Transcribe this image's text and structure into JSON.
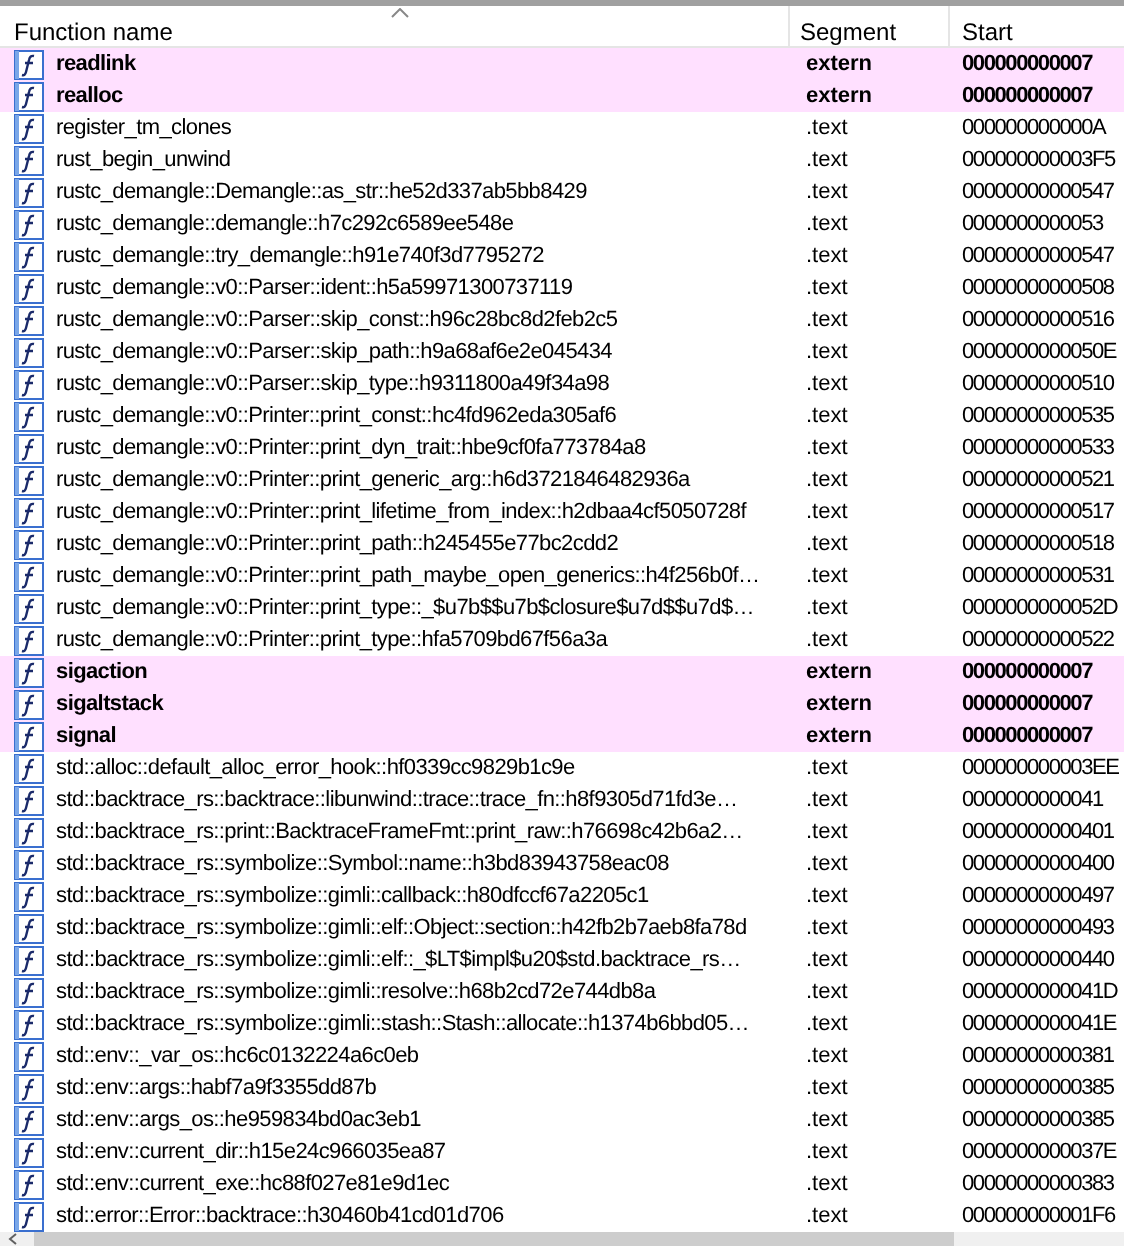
{
  "columns": [
    "Function name",
    "Segment",
    "Start"
  ],
  "rows": [
    {
      "name": "readlink",
      "segment": "extern",
      "start": "000000000007",
      "imported": true
    },
    {
      "name": "realloc",
      "segment": "extern",
      "start": "000000000007",
      "imported": true
    },
    {
      "name": "register_tm_clones",
      "segment": ".text",
      "start": "000000000000A",
      "imported": false
    },
    {
      "name": "rust_begin_unwind",
      "segment": ".text",
      "start": "000000000003F5",
      "imported": false
    },
    {
      "name": "rustc_demangle::Demangle::as_str::he52d337ab5bb8429",
      "segment": ".text",
      "start": "00000000000547",
      "imported": false
    },
    {
      "name": "rustc_demangle::demangle::h7c292c6589ee548e",
      "segment": ".text",
      "start": "0000000000053",
      "imported": false
    },
    {
      "name": "rustc_demangle::try_demangle::h91e740f3d7795272",
      "segment": ".text",
      "start": "00000000000547",
      "imported": false
    },
    {
      "name": "rustc_demangle::v0::Parser::ident::h5a59971300737119",
      "segment": ".text",
      "start": "00000000000508",
      "imported": false
    },
    {
      "name": "rustc_demangle::v0::Parser::skip_const::h96c28bc8d2feb2c5",
      "segment": ".text",
      "start": "00000000000516",
      "imported": false
    },
    {
      "name": "rustc_demangle::v0::Parser::skip_path::h9a68af6e2e045434",
      "segment": ".text",
      "start": "0000000000050E",
      "imported": false
    },
    {
      "name": "rustc_demangle::v0::Parser::skip_type::h9311800a49f34a98",
      "segment": ".text",
      "start": "00000000000510",
      "imported": false
    },
    {
      "name": "rustc_demangle::v0::Printer::print_const::hc4fd962eda305af6",
      "segment": ".text",
      "start": "00000000000535",
      "imported": false
    },
    {
      "name": "rustc_demangle::v0::Printer::print_dyn_trait::hbe9cf0fa773784a8",
      "segment": ".text",
      "start": "00000000000533",
      "imported": false
    },
    {
      "name": "rustc_demangle::v0::Printer::print_generic_arg::h6d3721846482936a",
      "segment": ".text",
      "start": "00000000000521",
      "imported": false
    },
    {
      "name": "rustc_demangle::v0::Printer::print_lifetime_from_index::h2dbaa4cf5050728f",
      "segment": ".text",
      "start": "00000000000517",
      "imported": false
    },
    {
      "name": "rustc_demangle::v0::Printer::print_path::h245455e77bc2cdd2",
      "segment": ".text",
      "start": "00000000000518",
      "imported": false
    },
    {
      "name": "rustc_demangle::v0::Printer::print_path_maybe_open_generics::h4f256b0f…",
      "segment": ".text",
      "start": "00000000000531",
      "imported": false
    },
    {
      "name": "rustc_demangle::v0::Printer::print_type::_$u7b$$u7b$closure$u7d$$u7d$…",
      "segment": ".text",
      "start": "0000000000052D",
      "imported": false
    },
    {
      "name": "rustc_demangle::v0::Printer::print_type::hfa5709bd67f56a3a",
      "segment": ".text",
      "start": "00000000000522",
      "imported": false
    },
    {
      "name": "sigaction",
      "segment": "extern",
      "start": "000000000007",
      "imported": true
    },
    {
      "name": "sigaltstack",
      "segment": "extern",
      "start": "000000000007",
      "imported": true
    },
    {
      "name": "signal",
      "segment": "extern",
      "start": "000000000007",
      "imported": true
    },
    {
      "name": "std::alloc::default_alloc_error_hook::hf0339cc9829b1c9e",
      "segment": ".text",
      "start": "000000000003EE",
      "imported": false
    },
    {
      "name": "std::backtrace_rs::backtrace::libunwind::trace::trace_fn::h8f9305d71fd3e…",
      "segment": ".text",
      "start": "0000000000041",
      "imported": false
    },
    {
      "name": "std::backtrace_rs::print::BacktraceFrameFmt::print_raw::h76698c42b6a2…",
      "segment": ".text",
      "start": "00000000000401",
      "imported": false
    },
    {
      "name": "std::backtrace_rs::symbolize::Symbol::name::h3bd83943758eac08",
      "segment": ".text",
      "start": "00000000000400",
      "imported": false
    },
    {
      "name": "std::backtrace_rs::symbolize::gimli::callback::h80dfccf67a2205c1",
      "segment": ".text",
      "start": "00000000000497",
      "imported": false
    },
    {
      "name": "std::backtrace_rs::symbolize::gimli::elf::Object::section::h42fb2b7aeb8fa78d",
      "segment": ".text",
      "start": "00000000000493",
      "imported": false
    },
    {
      "name": "std::backtrace_rs::symbolize::gimli::elf::_$LT$impl$u20$std.backtrace_rs…",
      "segment": ".text",
      "start": "00000000000440",
      "imported": false
    },
    {
      "name": "std::backtrace_rs::symbolize::gimli::resolve::h68b2cd72e744db8a",
      "segment": ".text",
      "start": "0000000000041D",
      "imported": false
    },
    {
      "name": "std::backtrace_rs::symbolize::gimli::stash::Stash::allocate::h1374b6bbd05…",
      "segment": ".text",
      "start": "0000000000041E",
      "imported": false
    },
    {
      "name": "std::env::_var_os::hc6c0132224a6c0eb",
      "segment": ".text",
      "start": "00000000000381",
      "imported": false
    },
    {
      "name": "std::env::args::habf7a9f3355dd87b",
      "segment": ".text",
      "start": "00000000000385",
      "imported": false
    },
    {
      "name": "std::env::args_os::he959834bd0ac3eb1",
      "segment": ".text",
      "start": "00000000000385",
      "imported": false
    },
    {
      "name": "std::env::current_dir::h15e24c966035ea87",
      "segment": ".text",
      "start": "0000000000037E",
      "imported": false
    },
    {
      "name": "std::env::current_exe::hc88f027e81e9d1ec",
      "segment": ".text",
      "start": "00000000000383",
      "imported": false
    },
    {
      "name": "std::error::Error::backtrace::h30460b41cd01d706",
      "segment": ".text",
      "start": "000000000001F6",
      "imported": false
    }
  ]
}
